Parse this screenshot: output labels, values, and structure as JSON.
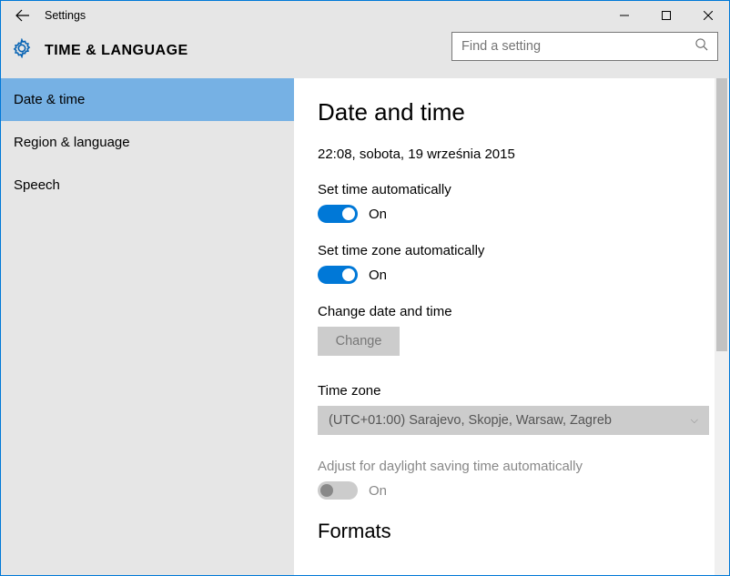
{
  "window": {
    "title": "Settings"
  },
  "header": {
    "section_title": "TIME & LANGUAGE"
  },
  "search": {
    "placeholder": "Find a setting"
  },
  "sidebar": {
    "items": [
      {
        "label": "Date & time",
        "selected": true
      },
      {
        "label": "Region & language",
        "selected": false
      },
      {
        "label": "Speech",
        "selected": false
      }
    ]
  },
  "main": {
    "heading": "Date and time",
    "current_datetime": "22:08, sobota, 19 września 2015",
    "set_time_auto": {
      "label": "Set time automatically",
      "state_text": "On",
      "on": true
    },
    "set_tz_auto": {
      "label": "Set time zone automatically",
      "state_text": "On",
      "on": true
    },
    "change_dt": {
      "label": "Change date and time",
      "button": "Change"
    },
    "timezone": {
      "label": "Time zone",
      "value": "(UTC+01:00) Sarajevo, Skopje, Warsaw, Zagreb"
    },
    "dst": {
      "label": "Adjust for daylight saving time automatically",
      "state_text": "On",
      "on": true,
      "disabled": true
    },
    "formats_heading": "Formats"
  }
}
